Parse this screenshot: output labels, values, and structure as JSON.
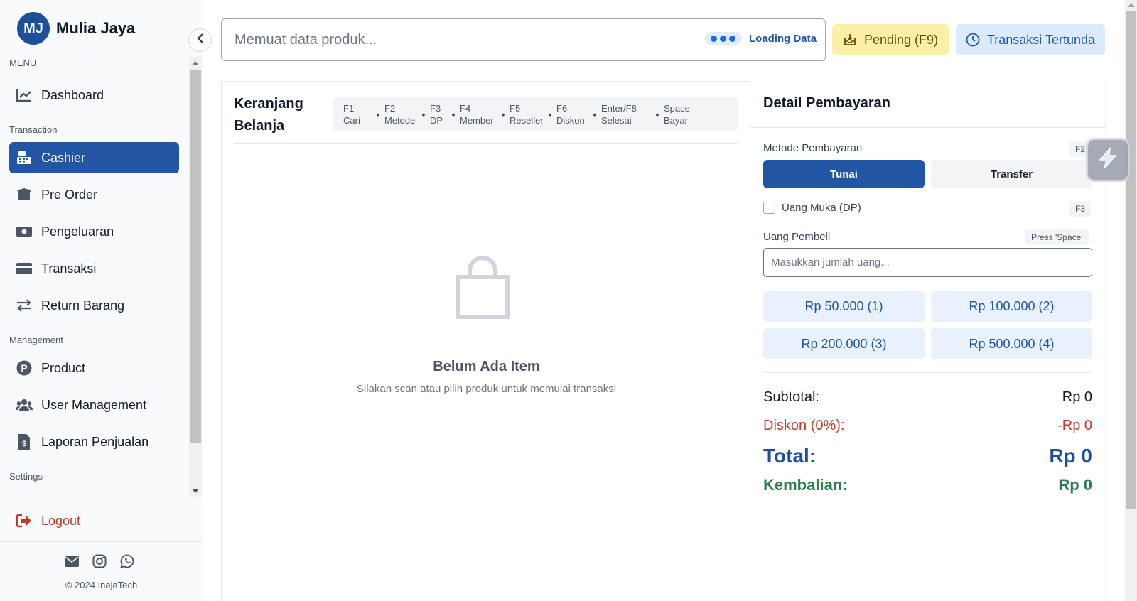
{
  "brand": {
    "initials": "MJ",
    "name": "Mulia Jaya"
  },
  "sidebar": {
    "sections": {
      "menu": "MENU",
      "transaction": "Transaction",
      "management": "Management",
      "settings": "Settings"
    },
    "items": [
      {
        "label": "Dashboard",
        "icon": "chart-line-icon",
        "active": false
      },
      {
        "label": "Cashier",
        "icon": "cash-register-icon",
        "active": true
      },
      {
        "label": "Pre Order",
        "icon": "box-open-icon",
        "active": false
      },
      {
        "label": "Pengeluaran",
        "icon": "money-bill-icon",
        "active": false
      },
      {
        "label": "Transaksi",
        "icon": "credit-card-icon",
        "active": false
      },
      {
        "label": "Return Barang",
        "icon": "exchange-icon",
        "active": false
      },
      {
        "label": "Product",
        "icon": "product-p-icon",
        "active": false
      },
      {
        "label": "User Management",
        "icon": "users-icon",
        "active": false
      },
      {
        "label": "Laporan Penjualan",
        "icon": "invoice-dollar-icon",
        "active": false
      },
      {
        "label": "Logout",
        "icon": "sign-out-icon",
        "active": false
      }
    ]
  },
  "footer": {
    "icons": [
      "email-icon",
      "instagram-icon",
      "whatsapp-icon"
    ],
    "copyright": "© 2024 InajaTech"
  },
  "topbar": {
    "search_placeholder": "Memuat data produk...",
    "loading_text": "Loading Data",
    "pending_label": "Pending (F9)",
    "tertunda_label": "Transaksi Tertunda"
  },
  "cart": {
    "title_line1": "Keranjang",
    "title_line2": "Belanja",
    "shortcuts": [
      {
        "key": "F1-",
        "action": "Cari"
      },
      {
        "key": "F2-",
        "action": "Metode"
      },
      {
        "key": "F3-",
        "action": "DP"
      },
      {
        "key": "F4-",
        "action": "Member"
      },
      {
        "key": "F5-",
        "action": "Reseller"
      },
      {
        "key": "F6-",
        "action": "Diskon"
      },
      {
        "key": "Enter/F8-",
        "action": "Selesai"
      },
      {
        "key": "Space-",
        "action": "Bayar"
      }
    ],
    "empty_title": "Belum Ada Item",
    "empty_subtitle": "Silakan scan atau pilih produk untuk memulai transaksi"
  },
  "payment": {
    "title": "Detail Pembayaran",
    "method_label": "Metode Pembayaran",
    "method_key": "F2",
    "methods": [
      "Tunai",
      "Transfer"
    ],
    "selected_method": "Tunai",
    "dp_label": "Uang Muka (DP)",
    "dp_key": "F3",
    "dp_checked": false,
    "cash_label": "Uang Pembeli",
    "cash_key": "Press 'Space'",
    "cash_placeholder": "Masukkan jumlah uang...",
    "quick_amounts": [
      "Rp 50.000 (1)",
      "Rp 100.000 (2)",
      "Rp 200.000 (3)",
      "Rp 500.000 (4)"
    ],
    "subtotal_label": "Subtotal:",
    "subtotal_value": "Rp 0",
    "discount_label": "Diskon (0%):",
    "discount_value": "-Rp 0",
    "total_label": "Total:",
    "total_value": "Rp 0",
    "change_label": "Kembalian:",
    "change_value": "Rp 0"
  },
  "colors": {
    "primary": "#2256a3",
    "pending_bg": "#fcefa7",
    "tertunda_bg": "#dbeafe",
    "danger": "#c0392b",
    "success": "#2e7d4f"
  }
}
